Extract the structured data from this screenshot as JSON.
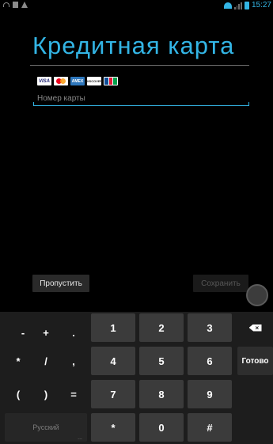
{
  "status_bar": {
    "time": "15:27"
  },
  "title": "Кредитная карта",
  "card_logos": [
    "visa-logo",
    "mastercard-logo",
    "amex-logo",
    "discover-logo",
    "jcb-logo"
  ],
  "card_logo_labels": {
    "visa": "VISA",
    "amex": "AMEX",
    "discover": "DISCOVER"
  },
  "card_input": {
    "placeholder": "Номер карты",
    "value": ""
  },
  "buttons": {
    "skip": "Пропустить",
    "save": "Сохранить"
  },
  "keyboard": {
    "row1": [
      "-",
      "+",
      ".",
      "1",
      "2",
      "3"
    ],
    "row2": [
      "*",
      "/",
      ",",
      "4",
      "5",
      "6"
    ],
    "row3": [
      "(",
      ")",
      "=",
      "7",
      "8",
      "9"
    ],
    "row4": [
      "Русский",
      "*",
      "0",
      "#"
    ],
    "done": "Готово"
  },
  "colors": {
    "accent": "#33b5e5",
    "background": "#000000",
    "key_bg": "#3b3b3b"
  }
}
